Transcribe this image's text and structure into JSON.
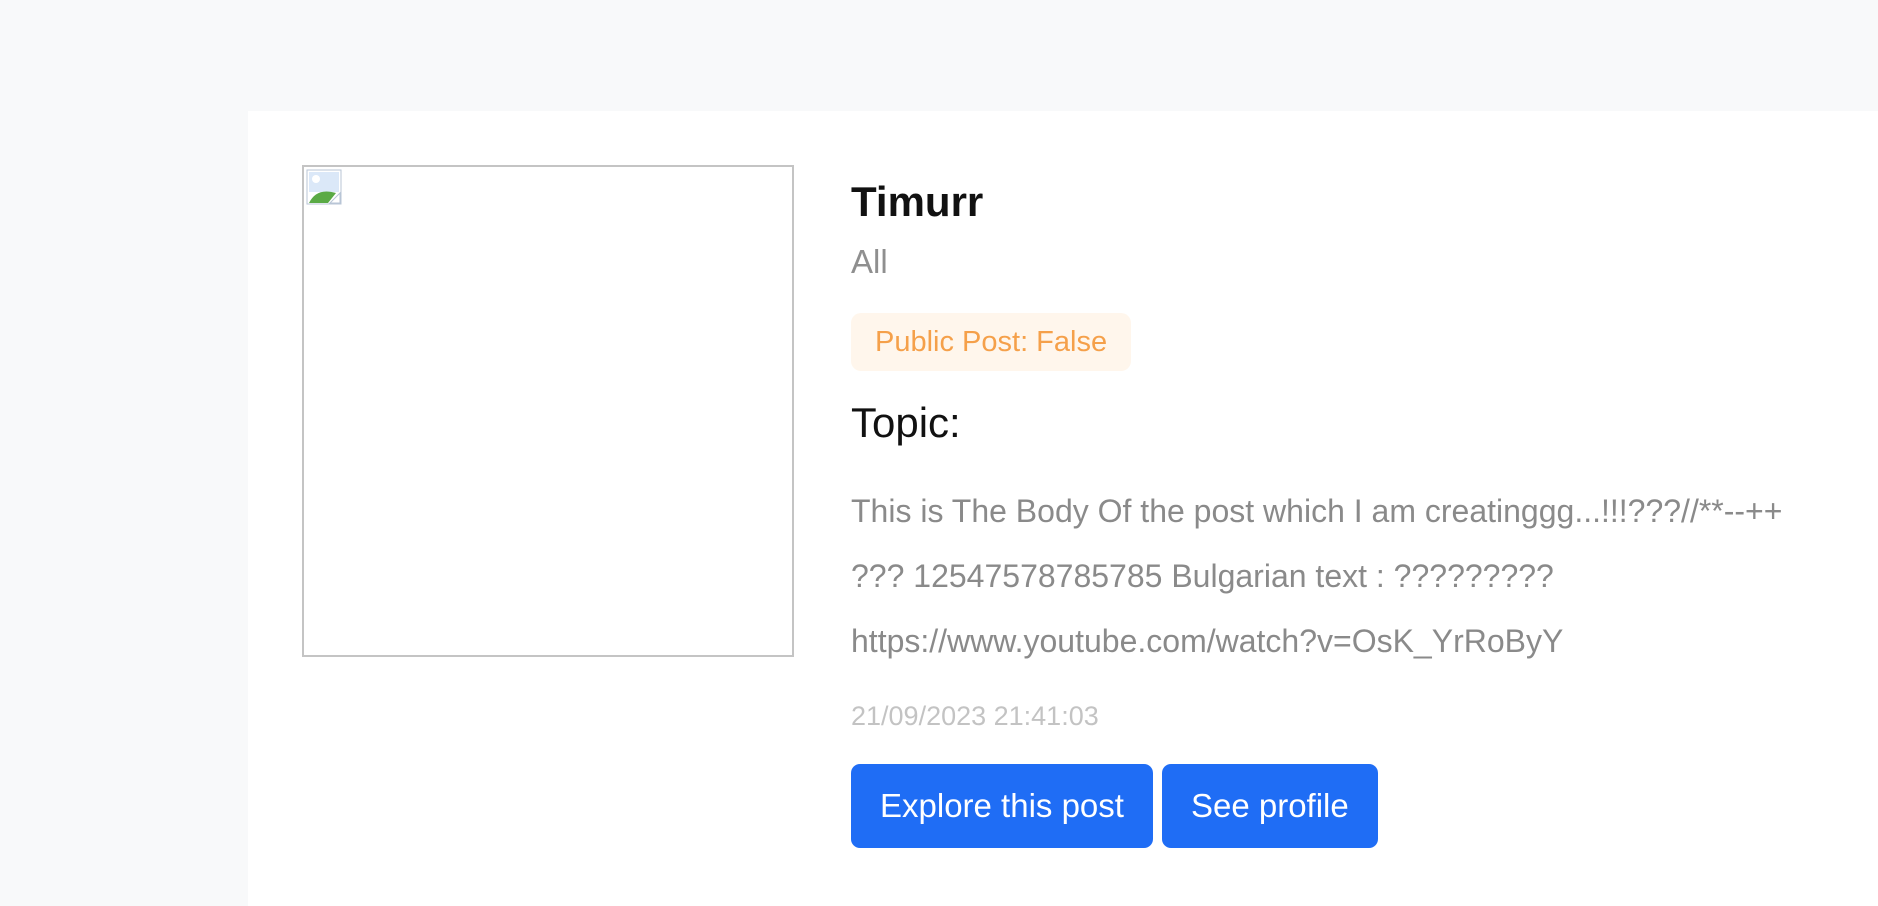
{
  "post": {
    "author": "Timurr",
    "audience": "All",
    "public_badge": "Public Post: False",
    "topic_label": "Topic:",
    "body": "This is The Body Of the post which I am creatinggg...!!!???//**--++ ??? 12547578785785 Bulgarian text : ????????? https://www.youtube.com/watch?v=OsK_YrRoByY",
    "timestamp": "21/09/2023 21:41:03",
    "image_icon": "broken-image-icon"
  },
  "actions": {
    "explore_label": "Explore this post",
    "profile_label": "See profile"
  },
  "colors": {
    "primary_button": "#1f6df5",
    "badge_text": "#f5a04a",
    "badge_background": "#fff6ec"
  }
}
